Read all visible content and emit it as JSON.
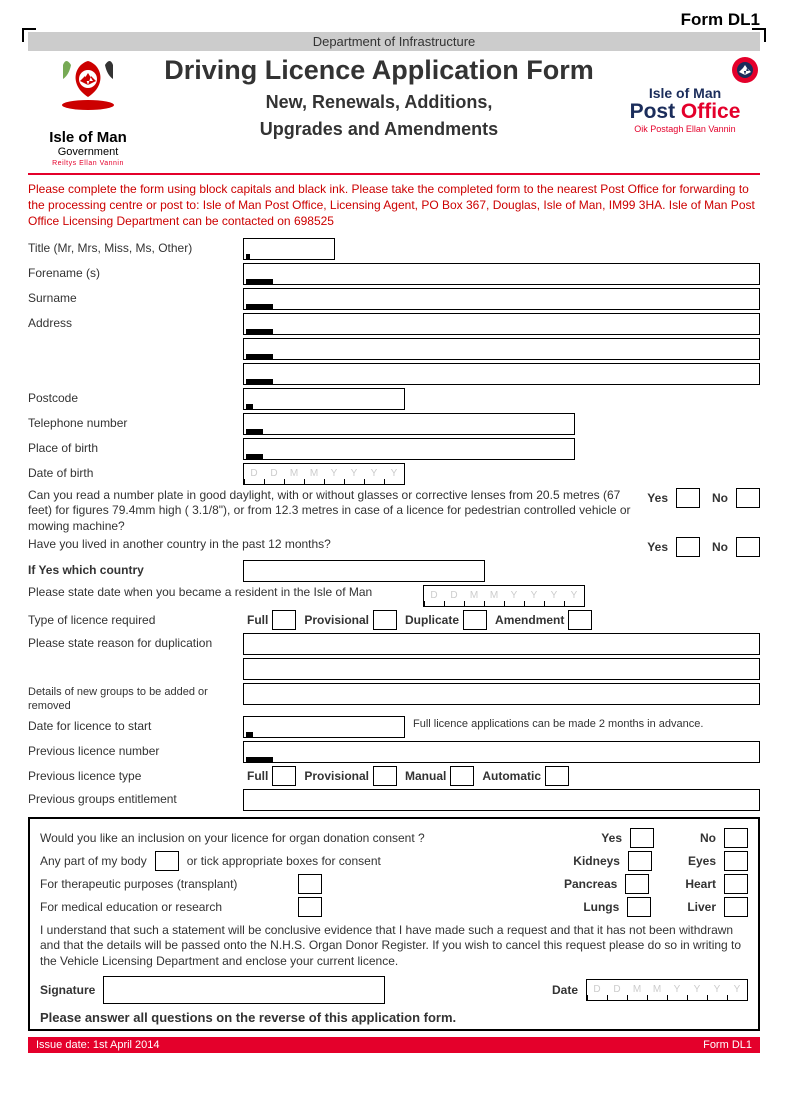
{
  "form_code": "Form DL1",
  "dept": "Department of Infrastructure",
  "title": "Driving Licence Application Form",
  "subtitle1": "New, Renewals, Additions,",
  "subtitle2": "Upgrades and Amendments",
  "gov": {
    "name": "Isle of Man",
    "sub": "Government",
    "tag": "Reiltys Ellan Vannin"
  },
  "po": {
    "l1": "Isle of Man",
    "l2a": "Post ",
    "l2b": "Office",
    "tag": "Oik Postagh Ellan Vannin"
  },
  "intro": "Please complete the form using block capitals and black ink. Please take the completed form to the nearest Post Office for forwarding to the processing centre or post to: Isle of Man Post Office, Licensing Agent, PO Box 367, Douglas, Isle of Man, IM99 3HA.  Isle of Man Post Office Licensing Department can be contacted on 698525",
  "labels": {
    "title": "Title (Mr, Mrs, Miss, Ms, Other)",
    "forename": "Forename (s)",
    "surname": "Surname",
    "address": "Address",
    "postcode": "Postcode",
    "telephone": "Telephone number",
    "pob": "Place of birth",
    "dob": "Date of birth",
    "eyesight": "Can you read a number plate in good daylight, with or without glasses or corrective lenses from 20.5 metres (67 feet) for figures 79.4mm high ( 3.1/8\"), or from 12.3 metres in case of a licence for pedestrian controlled vehicle or mowing machine?",
    "abroad": "Have you lived in another country in the past 12 months?",
    "ifyes": "If Yes which country",
    "resident": "Please state date when you became a resident in the Isle of Man",
    "lictype": "Type of licence required",
    "dupreason": "Please state reason for duplication",
    "groups": "Details of new groups to be added or removed",
    "startdate": "Date for licence to start",
    "startnote": "Full licence applications can be made 2 months in advance.",
    "prevno": "Previous licence number",
    "prevtype": "Previous licence type",
    "prevgroups": "Previous groups entitlement",
    "organ_q": "Would you like an inclusion on your licence for organ donation consent ?",
    "anypart": "Any part of my body",
    "tickboxes": "or tick appropriate boxes for consent",
    "therapeutic": "For therapeutic purposes (transplant)",
    "medical": "For medical education or research",
    "declaration": "I understand that such a statement will be conclusive evidence that I have made such a request and that it has not been withdrawn and that the details will be passed onto the N.H.S. Organ Donor Register. If you wish to cancel this request please do so in writing to the Vehicle Licensing Department and enclose your current licence.",
    "signature": "Signature",
    "date": "Date",
    "reverse": "Please answer all questions on the reverse of this application form."
  },
  "opts": {
    "yes": "Yes",
    "no": "No",
    "full": "Full",
    "provisional": "Provisional",
    "duplicate": "Duplicate",
    "amendment": "Amendment",
    "manual": "Manual",
    "automatic": "Automatic",
    "kidneys": "Kidneys",
    "eyes": "Eyes",
    "pancreas": "Pancreas",
    "heart": "Heart",
    "lungs": "Lungs",
    "liver": "Liver"
  },
  "dob_hint": [
    "D",
    "D",
    "M",
    "M",
    "Y",
    "Y",
    "Y",
    "Y"
  ],
  "footer": {
    "issue": "Issue date: 1st April 2014",
    "code": "Form DL1"
  }
}
